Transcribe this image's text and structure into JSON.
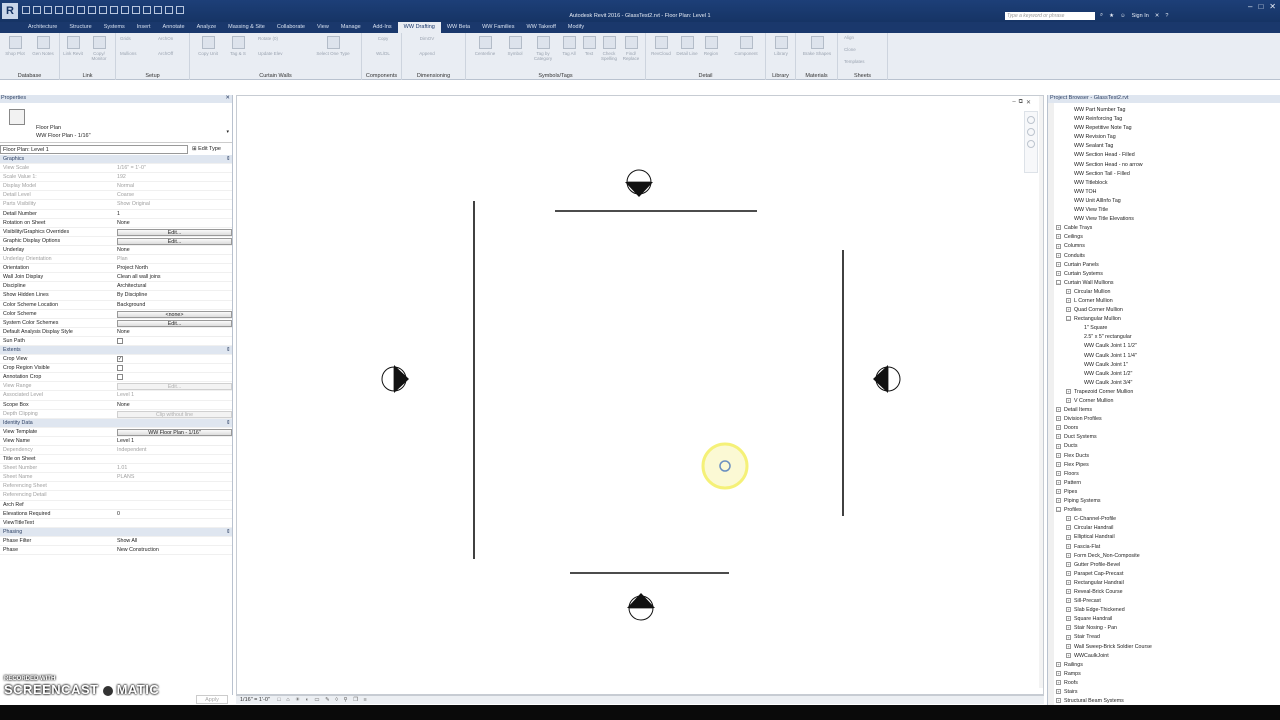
{
  "titlebar": {
    "logo": "R",
    "window_title": "Autodesk Revit 2016 -  GlassTest2.rvt - Floor Plan: Level 1",
    "search_placeholder": "Type a keyword or phrase",
    "sign_in": "Sign In",
    "min": "–",
    "max": "□",
    "close": "✕"
  },
  "tabs": [
    "Architecture",
    "Structure",
    "Systems",
    "Insert",
    "Annotate",
    "Analyze",
    "Massing & Site",
    "Collaborate",
    "View",
    "Manage",
    "Add-Ins",
    "WW Drafting",
    "WW Beta",
    "WW Families",
    "WW Takeoff",
    "Modify"
  ],
  "ribbon": {
    "groups": {
      "database": "Database",
      "link": "Link",
      "setup": "Setup",
      "curtain_walls": "Curtain Walls",
      "components": "Components",
      "dimensioning": "Dimensioning",
      "symbols_tags": "Symbols/Tags",
      "detail": "Detail",
      "library": "Library",
      "materials": "Materials",
      "sheets": "Sheets"
    },
    "buttons": {
      "shop_plot": "Shop Plot",
      "gen_notes": "Gen Notes",
      "link_revit": "Link Revit",
      "copy_monitor": "Copy/ Monitor",
      "grids": "Grids",
      "mullions": "Mullions",
      "arch_on": "ArchOn",
      "arch_off": "ArchOff",
      "rotate": "Rotate (0)",
      "update_elev": "Update Elev",
      "copy_unit": "Copy Unit",
      "tag_n_set": "Tag & S",
      "select_one_type": "Select One Type",
      "copy": "Copy",
      "wldl": "WL/DL",
      "dim_ov": "DimOV",
      "append": "Append",
      "centerline": "Centerline",
      "symbol": "Symbol",
      "tag_by_category": "Tag by Category",
      "tag_all": "Tag All",
      "text": "Text",
      "check_spelling": "Check Spelling",
      "find_replace": "Find/ Replace",
      "rev_cloud": "RevCloud",
      "detail_line": "Detail Line",
      "region": "Region",
      "component": "Component",
      "library": "Library",
      "brake_shapes": "Brake Shapes",
      "align": "Align",
      "clone": "Clone",
      "templates": "Templates"
    }
  },
  "properties": {
    "header": "Properties",
    "type_name": "Floor Plan",
    "type_sub": "WW Floor Plan - 1/16\"",
    "instance_selector": "Floor Plan: Level 1",
    "edit_type": "Edit Type",
    "apply": "Apply",
    "rows": [
      {
        "k": "Graphics",
        "cat": true
      },
      {
        "k": "View Scale",
        "v": "1/16\" = 1'-0\"",
        "dis": true
      },
      {
        "k": "Scale Value    1:",
        "v": "192",
        "dis": true
      },
      {
        "k": "Display Model",
        "v": "Normal",
        "dis": true
      },
      {
        "k": "Detail Level",
        "v": "Coarse",
        "dis": true
      },
      {
        "k": "Parts Visibility",
        "v": "Show Original",
        "dis": true
      },
      {
        "k": "Detail Number",
        "v": "1"
      },
      {
        "k": "Rotation on Sheet",
        "v": "None"
      },
      {
        "k": "Visibility/Graphics Overrides",
        "btn": "Edit..."
      },
      {
        "k": "Graphic Display Options",
        "btn": "Edit..."
      },
      {
        "k": "Underlay",
        "v": "None"
      },
      {
        "k": "Underlay Orientation",
        "v": "Plan",
        "dis": true
      },
      {
        "k": "Orientation",
        "v": "Project North"
      },
      {
        "k": "Wall Join Display",
        "v": "Clean all wall joins"
      },
      {
        "k": "Discipline",
        "v": "Architectural"
      },
      {
        "k": "Show Hidden Lines",
        "v": "By Discipline"
      },
      {
        "k": "Color Scheme Location",
        "v": "Background"
      },
      {
        "k": "Color Scheme",
        "btn": "<none>"
      },
      {
        "k": "System Color Schemes",
        "btn": "Edit..."
      },
      {
        "k": "Default Analysis Display Style",
        "v": "None"
      },
      {
        "k": "Sun Path",
        "chk": ""
      },
      {
        "k": "Extents",
        "cat": true
      },
      {
        "k": "Crop View",
        "chk": "✓"
      },
      {
        "k": "Crop Region Visible",
        "chk": ""
      },
      {
        "k": "Annotation Crop",
        "chk": ""
      },
      {
        "k": "View Range",
        "btn": "Edit...",
        "dis": true
      },
      {
        "k": "Associated Level",
        "v": "Level 1",
        "dis": true
      },
      {
        "k": "Scope Box",
        "v": "None"
      },
      {
        "k": "Depth Clipping",
        "btn": "Clip without line",
        "dis": true
      },
      {
        "k": "Identity Data",
        "cat": true
      },
      {
        "k": "View Template",
        "btn": "WW Floor Plan - 1/16\""
      },
      {
        "k": "View Name",
        "v": "Level 1"
      },
      {
        "k": "Dependency",
        "v": "Independent",
        "dis": true
      },
      {
        "k": "Title on Sheet",
        "v": ""
      },
      {
        "k": "Sheet Number",
        "v": "1.01",
        "dis": true
      },
      {
        "k": "Sheet Name",
        "v": "PLANS",
        "dis": true
      },
      {
        "k": "Referencing Sheet",
        "v": "",
        "dis": true
      },
      {
        "k": "Referencing Detail",
        "v": "",
        "dis": true
      },
      {
        "k": "Arch Ref",
        "v": ""
      },
      {
        "k": "Elevations Required",
        "v": "0"
      },
      {
        "k": "ViewTitleText",
        "v": ""
      },
      {
        "k": "Phasing",
        "cat": true
      },
      {
        "k": "Phase Filter",
        "v": "Show All"
      },
      {
        "k": "Phase",
        "v": "New Construction"
      }
    ]
  },
  "view": {
    "buttons": [
      "–",
      "⧉",
      "✕"
    ],
    "status_scale": "1/16\" = 1'-0\"",
    "status_icons": "□ ⌂ ☀ ◐ ▭ ✎ ◊ ⚲ ❐ ≡"
  },
  "browser": {
    "header": "Project Browser - GlassTest2.rvt",
    "items": [
      {
        "t": "WW Part Number Tag",
        "lvl": 2
      },
      {
        "t": "WW Reinforcing Tag",
        "lvl": 2
      },
      {
        "t": "WW Repetitive Note Tag",
        "lvl": 2
      },
      {
        "t": "WW Revision Tag",
        "lvl": 2
      },
      {
        "t": "WW Sealant Tag",
        "lvl": 2
      },
      {
        "t": "WW Section Head - Filled",
        "lvl": 2
      },
      {
        "t": "WW Section Head - no arrow",
        "lvl": 2
      },
      {
        "t": "WW Section Tail - Filled",
        "lvl": 2
      },
      {
        "t": "WW Titleblock",
        "lvl": 2
      },
      {
        "t": "WW TOH",
        "lvl": 2
      },
      {
        "t": "WW Unit AllInfo Tag",
        "lvl": 2
      },
      {
        "t": "WW View Title",
        "lvl": 2
      },
      {
        "t": "WW View Title Elevations",
        "lvl": 2
      },
      {
        "t": "Cable Trays",
        "lvl": 1,
        "exp": "+"
      },
      {
        "t": "Ceilings",
        "lvl": 1,
        "exp": "+"
      },
      {
        "t": "Columns",
        "lvl": 1,
        "exp": "+"
      },
      {
        "t": "Conduits",
        "lvl": 1,
        "exp": "+"
      },
      {
        "t": "Curtain Panels",
        "lvl": 1,
        "exp": "+"
      },
      {
        "t": "Curtain Systems",
        "lvl": 1,
        "exp": "+"
      },
      {
        "t": "Curtain Wall Mullions",
        "lvl": 1,
        "exp": "–"
      },
      {
        "t": "Circular Mullion",
        "lvl": 2,
        "exp": "+"
      },
      {
        "t": "L Corner Mullion",
        "lvl": 2,
        "exp": "+"
      },
      {
        "t": "Quad Corner Mullion",
        "lvl": 2,
        "exp": "+"
      },
      {
        "t": "Rectangular Mullion",
        "lvl": 2,
        "exp": "–"
      },
      {
        "t": "1\" Square",
        "lvl": 3
      },
      {
        "t": "2.5\" x 5\" rectangular",
        "lvl": 3
      },
      {
        "t": "WW Caulk Joint 1 1/2\"",
        "lvl": 3
      },
      {
        "t": "WW Caulk Joint 1 1/4\"",
        "lvl": 3
      },
      {
        "t": "WW Caulk Joint 1\"",
        "lvl": 3
      },
      {
        "t": "WW Caulk Joint 1/2\"",
        "lvl": 3
      },
      {
        "t": "WW Caulk Joint 3/4\"",
        "lvl": 3
      },
      {
        "t": "Trapezoid Corner Mullion",
        "lvl": 2,
        "exp": "+"
      },
      {
        "t": "V Corner Mullion",
        "lvl": 2,
        "exp": "+"
      },
      {
        "t": "Detail Items",
        "lvl": 1,
        "exp": "+"
      },
      {
        "t": "Division Profiles",
        "lvl": 1,
        "exp": "+"
      },
      {
        "t": "Doors",
        "lvl": 1,
        "exp": "+"
      },
      {
        "t": "Duct Systems",
        "lvl": 1,
        "exp": "+"
      },
      {
        "t": "Ducts",
        "lvl": 1,
        "exp": "+"
      },
      {
        "t": "Flex Ducts",
        "lvl": 1,
        "exp": "+"
      },
      {
        "t": "Flex Pipes",
        "lvl": 1,
        "exp": "+"
      },
      {
        "t": "Floors",
        "lvl": 1,
        "exp": "+"
      },
      {
        "t": "Pattern",
        "lvl": 1,
        "exp": "+"
      },
      {
        "t": "Pipes",
        "lvl": 1,
        "exp": "+"
      },
      {
        "t": "Piping Systems",
        "lvl": 1,
        "exp": "+"
      },
      {
        "t": "Profiles",
        "lvl": 1,
        "exp": "–"
      },
      {
        "t": "C-Channel-Profile",
        "lvl": 2,
        "exp": "+"
      },
      {
        "t": "Circular Handrail",
        "lvl": 2,
        "exp": "+"
      },
      {
        "t": "Elliptical Handrail",
        "lvl": 2,
        "exp": "+"
      },
      {
        "t": "Fascia-Flat",
        "lvl": 2,
        "exp": "+"
      },
      {
        "t": "Form Deck_Non-Composite",
        "lvl": 2,
        "exp": "+"
      },
      {
        "t": "Gutter Profile-Bevel",
        "lvl": 2,
        "exp": "+"
      },
      {
        "t": "Parapet Cap-Precast",
        "lvl": 2,
        "exp": "+"
      },
      {
        "t": "Rectangular Handrail",
        "lvl": 2,
        "exp": "+"
      },
      {
        "t": "Reveal-Brick Course",
        "lvl": 2,
        "exp": "+"
      },
      {
        "t": "Sill-Precast",
        "lvl": 2,
        "exp": "+"
      },
      {
        "t": "Slab Edge-Thickened",
        "lvl": 2,
        "exp": "+"
      },
      {
        "t": "Square Handrail",
        "lvl": 2,
        "exp": "+"
      },
      {
        "t": "Stair Nosing - Pan",
        "lvl": 2,
        "exp": "+"
      },
      {
        "t": "Stair Tread",
        "lvl": 2,
        "exp": "+"
      },
      {
        "t": "Wall Sweep-Brick Soldier Course",
        "lvl": 2,
        "exp": "+"
      },
      {
        "t": "WWCaulkJoint",
        "lvl": 2,
        "exp": "+"
      },
      {
        "t": "Railings",
        "lvl": 1,
        "exp": "+"
      },
      {
        "t": "Ramps",
        "lvl": 1,
        "exp": "+"
      },
      {
        "t": "Roofs",
        "lvl": 1,
        "exp": "+"
      },
      {
        "t": "Stairs",
        "lvl": 1,
        "exp": "+"
      },
      {
        "t": "Structural Beam Systems",
        "lvl": 1,
        "exp": "+"
      }
    ]
  },
  "watermark": {
    "line1": "RECORDED WITH",
    "line2a": "SCREENCAST",
    "line2b": "MATIC"
  },
  "colors": {
    "title_bar": "#163465",
    "ribbon_bg": "#e9edf3",
    "cursor_highlight": "#f5f06a",
    "category_row": "#dfe6f0"
  }
}
